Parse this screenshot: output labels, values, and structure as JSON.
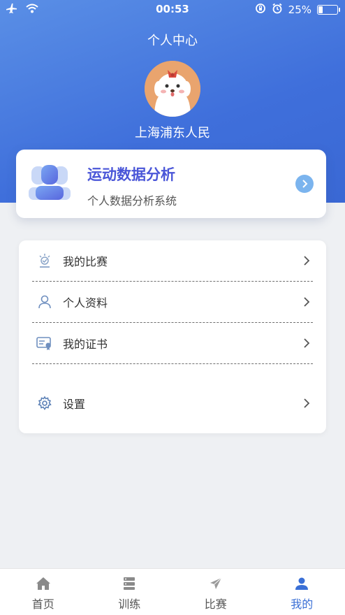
{
  "status_bar": {
    "time": "00:53",
    "battery": "25%",
    "battery_level": 0.25
  },
  "header": {
    "title": "个人中心",
    "username": "上海浦东人民"
  },
  "analysis_card": {
    "title": "运动数据分析",
    "subtitle": "个人数据分析系统"
  },
  "menu": {
    "items": [
      {
        "label": "我的比赛",
        "icon": "medal-icon"
      },
      {
        "label": "个人资料",
        "icon": "person-icon"
      },
      {
        "label": "我的证书",
        "icon": "certificate-icon"
      },
      {
        "label": "设置",
        "icon": "gear-icon"
      }
    ]
  },
  "tabbar": {
    "tabs": [
      {
        "label": "首页",
        "icon": "home-icon"
      },
      {
        "label": "训练",
        "icon": "training-icon"
      },
      {
        "label": "比赛",
        "icon": "paper-plane-icon"
      },
      {
        "label": "我的",
        "icon": "user-icon",
        "active": true
      }
    ]
  },
  "colors": {
    "accent": "#3a6fd6",
    "hero_start": "#5a8fe6",
    "hero_end": "#3a68d4",
    "analysis_title": "#4a56d8"
  }
}
